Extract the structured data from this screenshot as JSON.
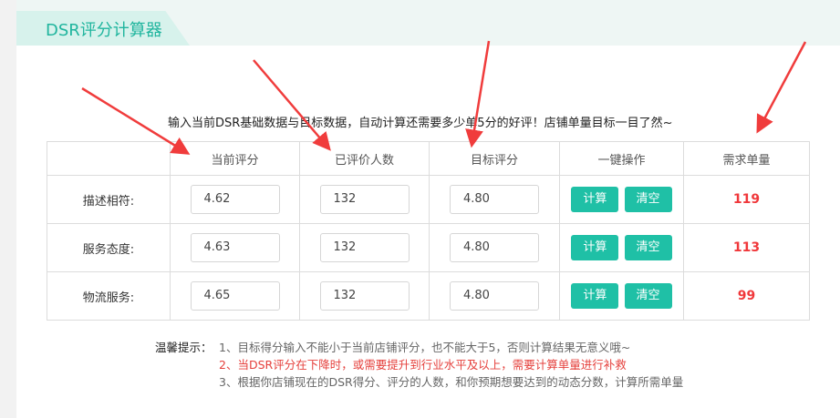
{
  "header": {
    "title": "DSR评分计算器"
  },
  "intro": "输入当前DSR基础数据与目标数据，自动计算还需要多少单5分的好评！店铺单量目标一目了然~",
  "table": {
    "headers": [
      "",
      "当前评分",
      "已评价人数",
      "目标评分",
      "一键操作",
      "需求单量"
    ],
    "rows": [
      {
        "label": "描述相符:",
        "current": "4.62",
        "count": "132",
        "target": "4.80",
        "calc": "计算",
        "clear": "清空",
        "needed": "119"
      },
      {
        "label": "服务态度:",
        "current": "4.63",
        "count": "132",
        "target": "4.80",
        "calc": "计算",
        "clear": "清空",
        "needed": "113"
      },
      {
        "label": "物流服务:",
        "current": "4.65",
        "count": "132",
        "target": "4.80",
        "calc": "计算",
        "clear": "清空",
        "needed": "99"
      }
    ]
  },
  "tips": {
    "lead": "温馨提示：",
    "items": [
      "1、目标得分输入不能小于当前店铺评分，也不能大于5，否则计算结果无意义哦~",
      "2、当DSR评分在下降时，或需要提升到行业水平及以上，需要计算单量进行补救",
      "3、根据你店铺现在的DSR得分、评分的人数，和你预期想要达到的动态分数，计算所需单量"
    ]
  },
  "colors": {
    "accent": "#1fc0a6",
    "title": "#20b59e",
    "result": "#f0373a",
    "warning": "#e5403c",
    "arrow": "#f03c3c"
  }
}
